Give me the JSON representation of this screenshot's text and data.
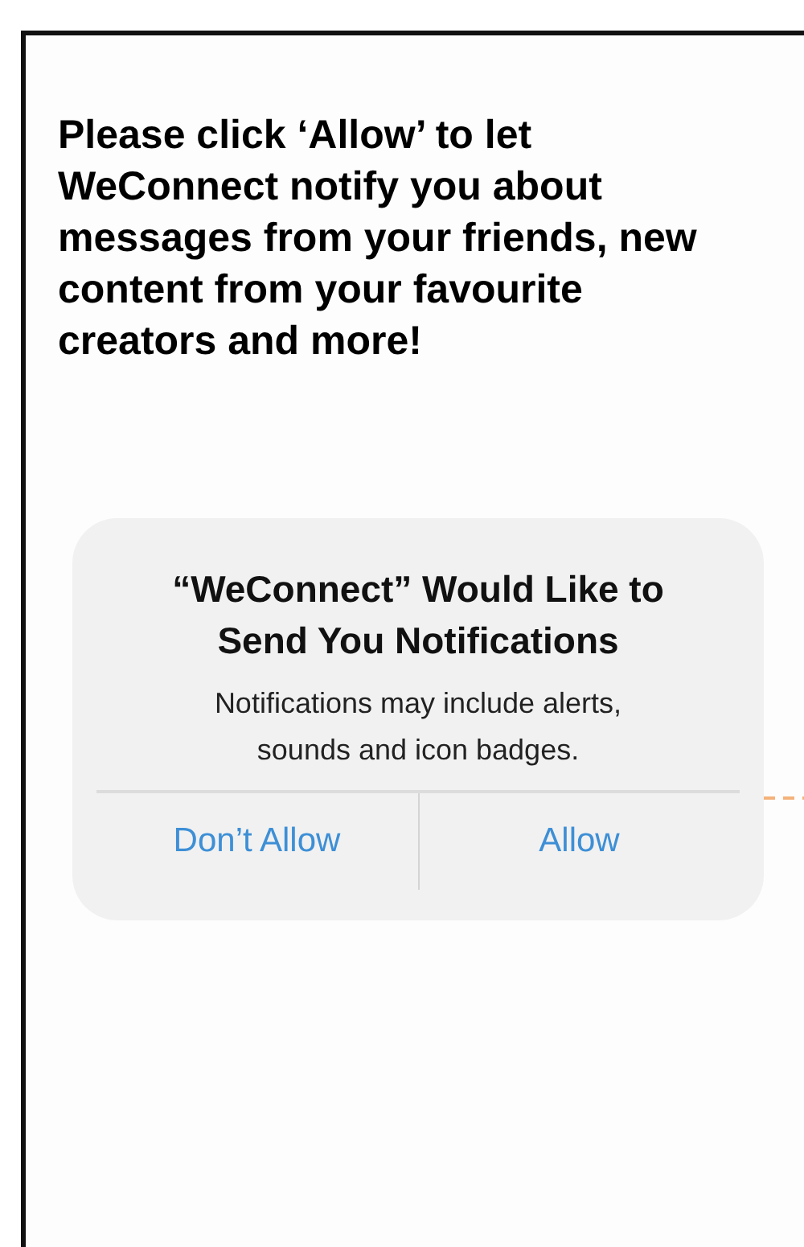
{
  "message": "Please click ‘Allow’ to let WeConnect notify you about messages from your friends, new content from your favourite creators and more!",
  "alert": {
    "title": "“WeConnect” Would Like to Send You Notifications",
    "body": "Notifications may include alerts, sounds and icon badges.",
    "buttons": [
      "Don’t Allow",
      "Allow"
    ]
  }
}
